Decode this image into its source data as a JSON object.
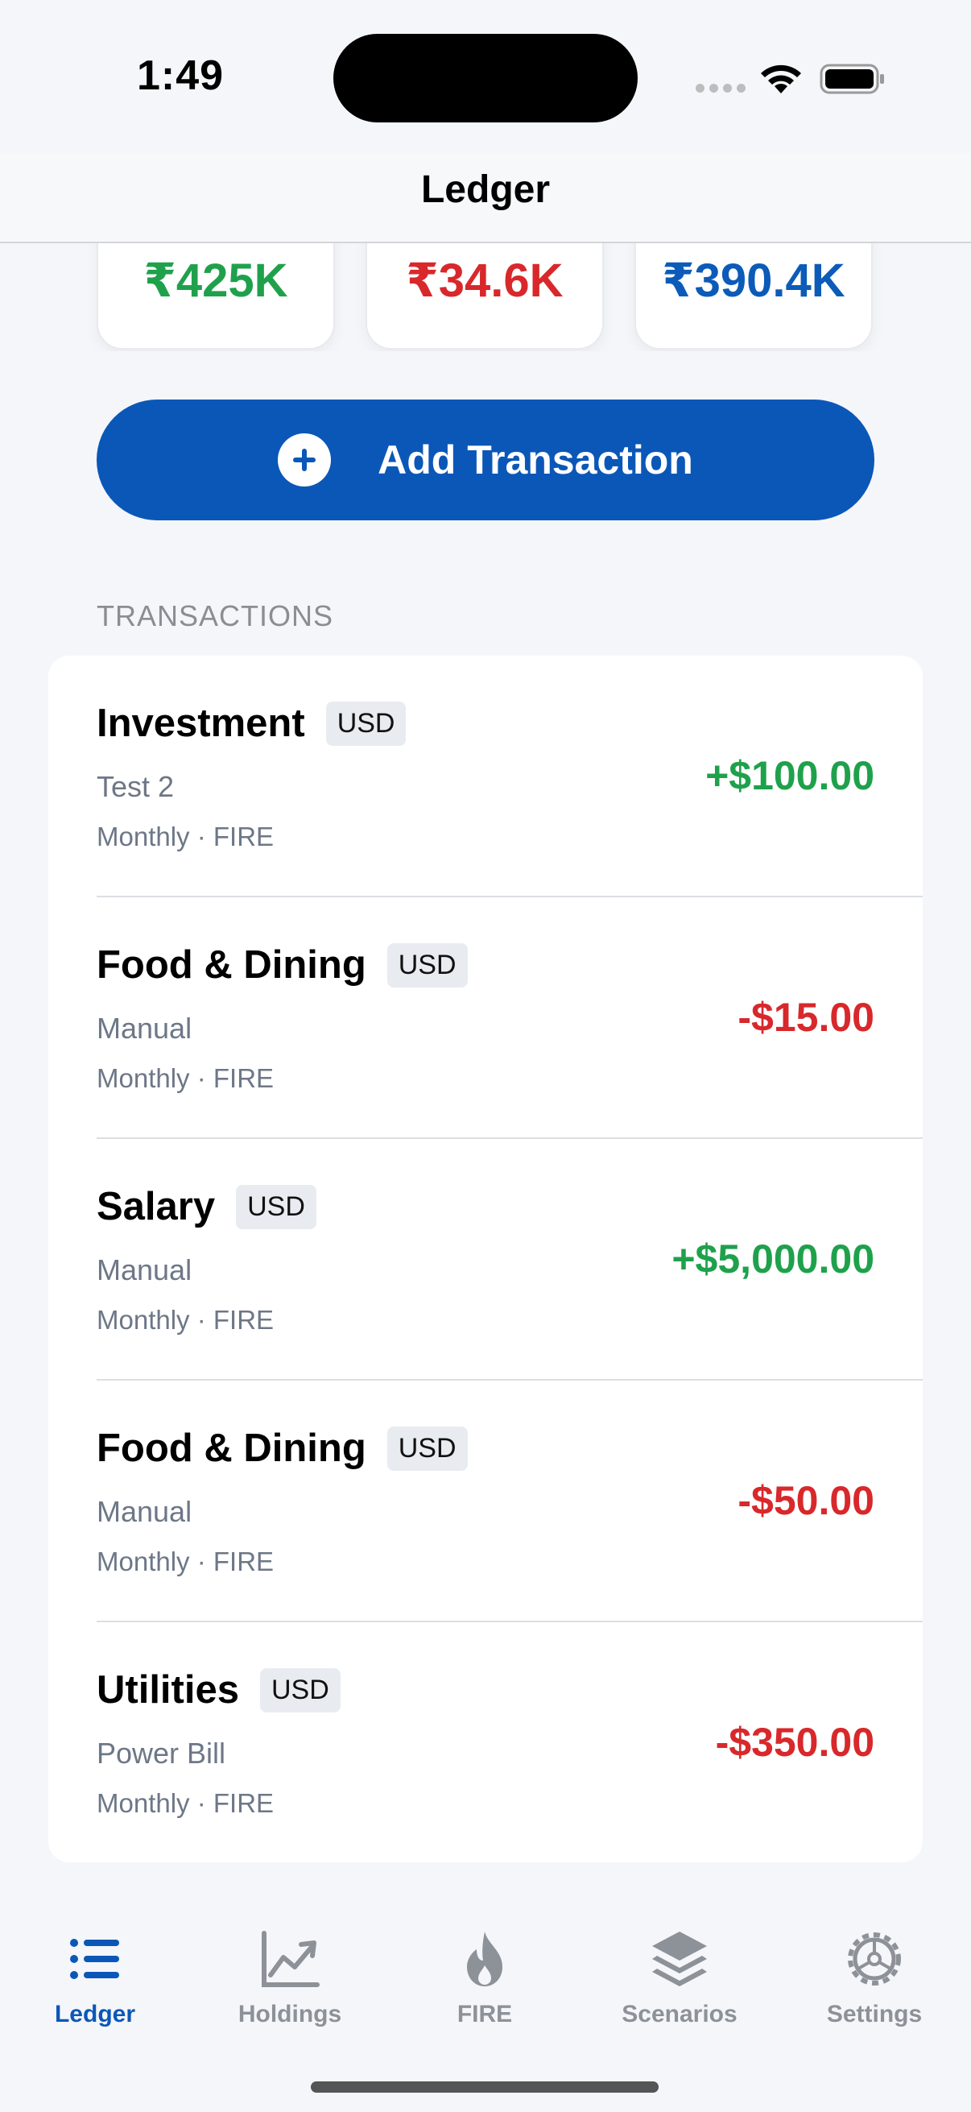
{
  "status_bar": {
    "time": "1:49"
  },
  "nav": {
    "title": "Ledger"
  },
  "summary_cards": [
    {
      "value": "₹425K",
      "color": "#1fa14c"
    },
    {
      "value": "₹34.6K",
      "color": "#d8282b"
    },
    {
      "value": "₹390.4K",
      "color": "#0c5bb8"
    }
  ],
  "add_button": {
    "label": "Add Transaction",
    "icon": "plus-circle-icon"
  },
  "section": {
    "header": "TRANSACTIONS"
  },
  "transactions": [
    {
      "title": "Investment",
      "currency": "USD",
      "note": "Test 2",
      "meta": "Monthly · FIRE",
      "amount": "+$100.00",
      "type": "income"
    },
    {
      "title": "Food & Dining",
      "currency": "USD",
      "note": "Manual",
      "meta": "Monthly · FIRE",
      "amount": "-$15.00",
      "type": "expense"
    },
    {
      "title": "Salary",
      "currency": "USD",
      "note": "Manual",
      "meta": "Monthly · FIRE",
      "amount": "+$5,000.00",
      "type": "income"
    },
    {
      "title": "Food & Dining",
      "currency": "USD",
      "note": "Manual",
      "meta": "Monthly · FIRE",
      "amount": "-$50.00",
      "type": "expense"
    },
    {
      "title": "Utilities",
      "currency": "USD",
      "note": "Power Bill",
      "meta": "Monthly · FIRE",
      "amount": "-$350.00",
      "type": "expense"
    }
  ],
  "tabs": [
    {
      "label": "Ledger",
      "icon": "list-icon",
      "active": true
    },
    {
      "label": "Holdings",
      "icon": "chart-icon",
      "active": false
    },
    {
      "label": "FIRE",
      "icon": "flame-icon",
      "active": false
    },
    {
      "label": "Scenarios",
      "icon": "layers-icon",
      "active": false
    },
    {
      "label": "Settings",
      "icon": "gear-icon",
      "active": false
    }
  ],
  "colors": {
    "accent": "#0b57b8",
    "income": "#1fa14c",
    "expense": "#d8282b",
    "tab_inactive": "#8d9198"
  }
}
